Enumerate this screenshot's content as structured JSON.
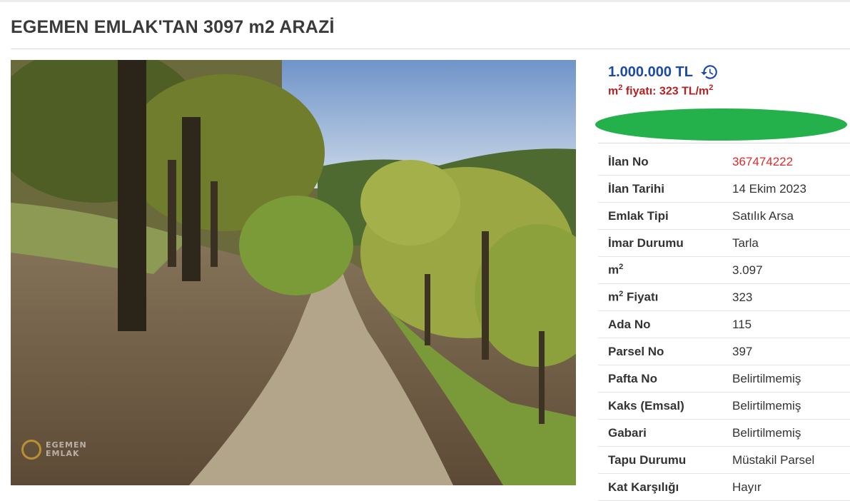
{
  "listing": {
    "title": "EGEMEN EMLAK'TAN 3097 m2 ARAZİ",
    "price": "1.000.000 TL",
    "m2_price_prefix": "m",
    "m2_price_sup": "2",
    "m2_price_text": " fiyatı: 323 TL/m",
    "m2_price_suffix_sup": "2",
    "watermark_line1": "EGEMEN",
    "watermark_line2": "EMLAK",
    "history_icon": "history-icon",
    "colors": {
      "price": "#1c4aa6",
      "m2_price": "#b32222",
      "listing_no": "#e02b2b",
      "redaction": "#24b04b"
    }
  },
  "details": [
    {
      "key": "İlan No",
      "value": "367474222"
    },
    {
      "key": "İlan Tarihi",
      "value": "14 Ekim 2023"
    },
    {
      "key": "Emlak Tipi",
      "value": "Satılık Arsa"
    },
    {
      "key": "İmar Durumu",
      "value": "Tarla"
    },
    {
      "key": "m",
      "key_sup": "2",
      "value": "3.097"
    },
    {
      "key": "m",
      "key_sup": "2",
      "key_rest": " Fiyatı",
      "value": "323"
    },
    {
      "key": "Ada No",
      "value": "115"
    },
    {
      "key": "Parsel No",
      "value": "397"
    },
    {
      "key": "Pafta No",
      "value": "Belirtilmemiş"
    },
    {
      "key": "Kaks (Emsal)",
      "value": "Belirtilmemiş"
    },
    {
      "key": "Gabari",
      "value": "Belirtilmemiş"
    },
    {
      "key": "Tapu Durumu",
      "value": "Müstakil Parsel"
    },
    {
      "key": "Kat Karşılığı",
      "value": "Hayır"
    }
  ]
}
